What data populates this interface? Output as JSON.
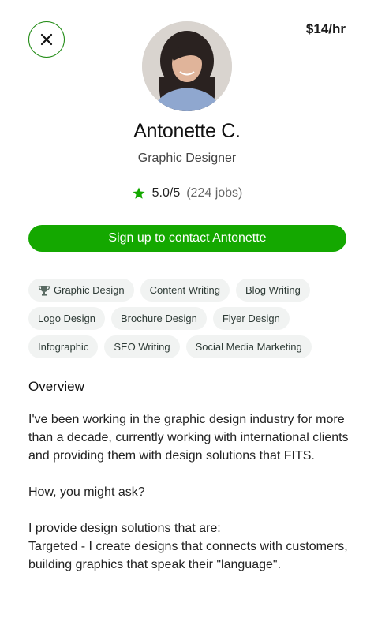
{
  "header": {
    "rate": "$14/hr"
  },
  "profile": {
    "name": "Antonette C.",
    "title": "Graphic Designer",
    "rating": "5.0/5",
    "jobs": "(224 jobs)"
  },
  "cta": {
    "label": "Sign up to contact Antonette"
  },
  "skills": [
    [
      "Graphic Design",
      "Content Writing",
      "Blog Writing"
    ],
    [
      "Logo Design",
      "Brochure Design",
      "Flyer Design"
    ],
    [
      "Infographic",
      "SEO Writing",
      "Social Media Marketing"
    ]
  ],
  "overview": {
    "heading": "Overview",
    "paragraph1": "I've been working in the graphic design industry for more than a decade, currently working with international clients and providing them with design solutions that FITS.",
    "paragraph2": "How, you might ask?",
    "paragraph3_line1": "I provide design solutions that are:",
    "paragraph3_line2": "Targeted - I create designs that connects with customers, building graphics that speak their \"language\"."
  },
  "colors": {
    "accent": "#14a800",
    "chip_bg": "#f1f3f2"
  }
}
